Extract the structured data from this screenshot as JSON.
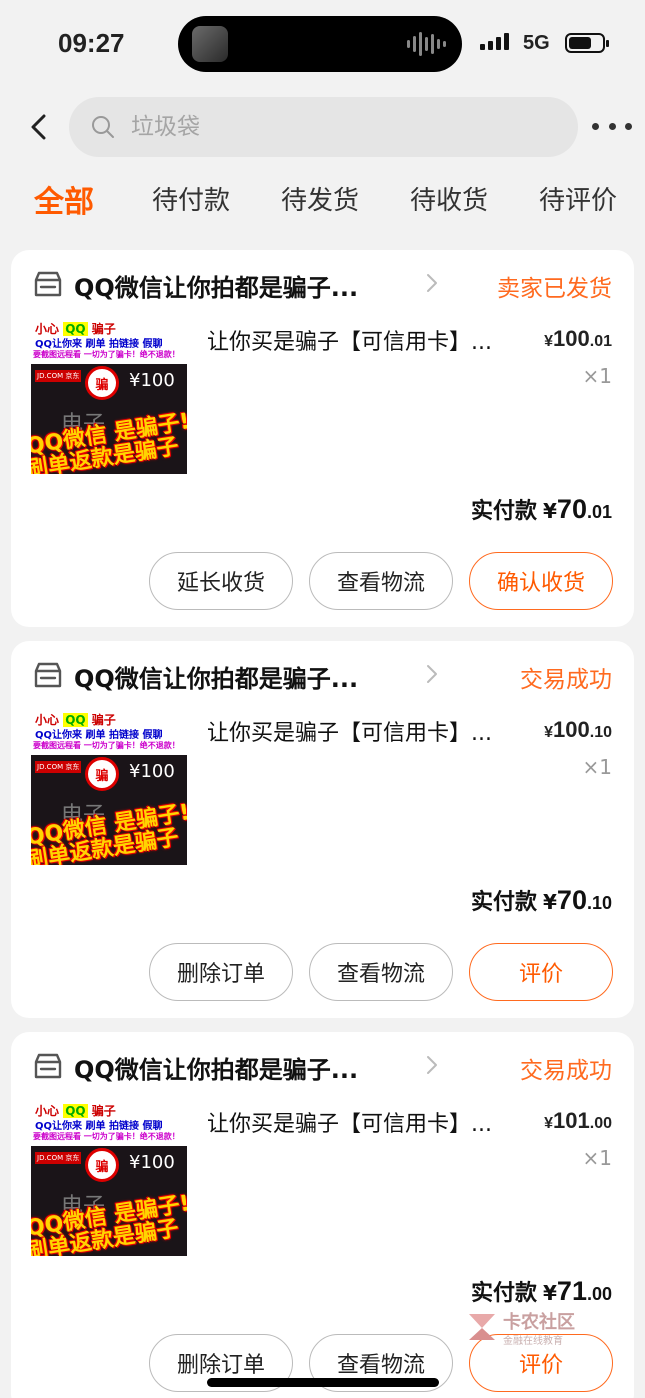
{
  "status_bar": {
    "time": "09:27",
    "network": "5G",
    "battery_level": 0.7
  },
  "search": {
    "placeholder": "垃圾袋"
  },
  "tabs": [
    "全部",
    "待付款",
    "待发货",
    "待收货",
    "待评价"
  ],
  "thumbnail_text": {
    "line1_a": "小心",
    "line1_b": "QQ",
    "line1_c": "骗子",
    "line2": "QQ让你来 刷单 拍链接 假聊",
    "line3": "要截图远程看 一切为了骗卡！绝不退款！",
    "jd": "JD.COM 京东",
    "stamp": "骗",
    "price": "¥100",
    "dz": "电子",
    "scam1": "QQ微信 是骗子!",
    "scam2": "刷单返款是骗子"
  },
  "orders": [
    {
      "shop": "QQ微信让你拍都是骗子...",
      "status": "卖家已发货",
      "title": "让你买是骗子【可信用卡】...",
      "unit_currency": "¥",
      "unit_int": "100",
      "unit_dec": ".01",
      "qty": "×1",
      "paid_label": "实付款",
      "paid_currency": "¥",
      "paid_int": "70",
      "paid_dec": ".01",
      "buttons": [
        "延长收货",
        "查看物流",
        "确认收货"
      ]
    },
    {
      "shop": "QQ微信让你拍都是骗子...",
      "status": "交易成功",
      "title": "让你买是骗子【可信用卡】...",
      "unit_currency": "¥",
      "unit_int": "100",
      "unit_dec": ".10",
      "qty": "×1",
      "paid_label": "实付款",
      "paid_currency": "¥",
      "paid_int": "70",
      "paid_dec": ".10",
      "buttons": [
        "删除订单",
        "查看物流",
        "评价"
      ]
    },
    {
      "shop": "QQ微信让你拍都是骗子...",
      "status": "交易成功",
      "title": "让你买是骗子【可信用卡】...",
      "unit_currency": "¥",
      "unit_int": "101",
      "unit_dec": ".00",
      "qty": "×1",
      "paid_label": "实付款",
      "paid_currency": "¥",
      "paid_int": "71",
      "paid_dec": ".00",
      "buttons": [
        "删除订单",
        "查看物流",
        "评价"
      ]
    }
  ],
  "watermark": {
    "text": "卡农社区",
    "sub": "金融在线教育"
  },
  "colors": {
    "accent": "#ff5a00",
    "background": "#f2f2f2"
  }
}
